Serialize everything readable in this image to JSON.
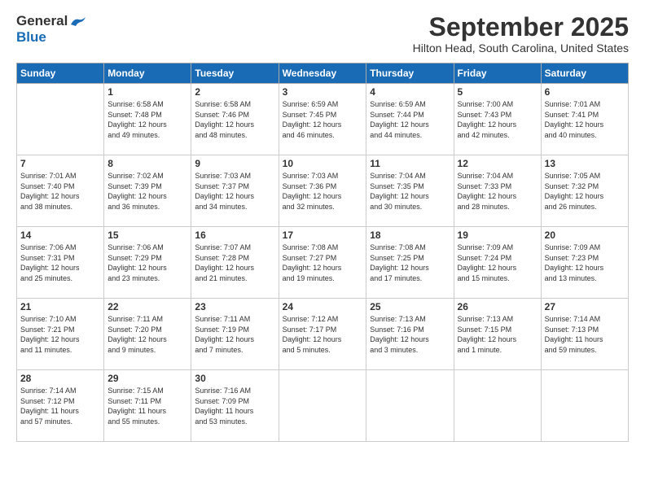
{
  "header": {
    "logo_general": "General",
    "logo_blue": "Blue",
    "month_title": "September 2025",
    "location": "Hilton Head, South Carolina, United States"
  },
  "calendar": {
    "days_of_week": [
      "Sunday",
      "Monday",
      "Tuesday",
      "Wednesday",
      "Thursday",
      "Friday",
      "Saturday"
    ],
    "weeks": [
      [
        {
          "day": "",
          "info": ""
        },
        {
          "day": "1",
          "info": "Sunrise: 6:58 AM\nSunset: 7:48 PM\nDaylight: 12 hours\nand 49 minutes."
        },
        {
          "day": "2",
          "info": "Sunrise: 6:58 AM\nSunset: 7:46 PM\nDaylight: 12 hours\nand 48 minutes."
        },
        {
          "day": "3",
          "info": "Sunrise: 6:59 AM\nSunset: 7:45 PM\nDaylight: 12 hours\nand 46 minutes."
        },
        {
          "day": "4",
          "info": "Sunrise: 6:59 AM\nSunset: 7:44 PM\nDaylight: 12 hours\nand 44 minutes."
        },
        {
          "day": "5",
          "info": "Sunrise: 7:00 AM\nSunset: 7:43 PM\nDaylight: 12 hours\nand 42 minutes."
        },
        {
          "day": "6",
          "info": "Sunrise: 7:01 AM\nSunset: 7:41 PM\nDaylight: 12 hours\nand 40 minutes."
        }
      ],
      [
        {
          "day": "7",
          "info": "Sunrise: 7:01 AM\nSunset: 7:40 PM\nDaylight: 12 hours\nand 38 minutes."
        },
        {
          "day": "8",
          "info": "Sunrise: 7:02 AM\nSunset: 7:39 PM\nDaylight: 12 hours\nand 36 minutes."
        },
        {
          "day": "9",
          "info": "Sunrise: 7:03 AM\nSunset: 7:37 PM\nDaylight: 12 hours\nand 34 minutes."
        },
        {
          "day": "10",
          "info": "Sunrise: 7:03 AM\nSunset: 7:36 PM\nDaylight: 12 hours\nand 32 minutes."
        },
        {
          "day": "11",
          "info": "Sunrise: 7:04 AM\nSunset: 7:35 PM\nDaylight: 12 hours\nand 30 minutes."
        },
        {
          "day": "12",
          "info": "Sunrise: 7:04 AM\nSunset: 7:33 PM\nDaylight: 12 hours\nand 28 minutes."
        },
        {
          "day": "13",
          "info": "Sunrise: 7:05 AM\nSunset: 7:32 PM\nDaylight: 12 hours\nand 26 minutes."
        }
      ],
      [
        {
          "day": "14",
          "info": "Sunrise: 7:06 AM\nSunset: 7:31 PM\nDaylight: 12 hours\nand 25 minutes."
        },
        {
          "day": "15",
          "info": "Sunrise: 7:06 AM\nSunset: 7:29 PM\nDaylight: 12 hours\nand 23 minutes."
        },
        {
          "day": "16",
          "info": "Sunrise: 7:07 AM\nSunset: 7:28 PM\nDaylight: 12 hours\nand 21 minutes."
        },
        {
          "day": "17",
          "info": "Sunrise: 7:08 AM\nSunset: 7:27 PM\nDaylight: 12 hours\nand 19 minutes."
        },
        {
          "day": "18",
          "info": "Sunrise: 7:08 AM\nSunset: 7:25 PM\nDaylight: 12 hours\nand 17 minutes."
        },
        {
          "day": "19",
          "info": "Sunrise: 7:09 AM\nSunset: 7:24 PM\nDaylight: 12 hours\nand 15 minutes."
        },
        {
          "day": "20",
          "info": "Sunrise: 7:09 AM\nSunset: 7:23 PM\nDaylight: 12 hours\nand 13 minutes."
        }
      ],
      [
        {
          "day": "21",
          "info": "Sunrise: 7:10 AM\nSunset: 7:21 PM\nDaylight: 12 hours\nand 11 minutes."
        },
        {
          "day": "22",
          "info": "Sunrise: 7:11 AM\nSunset: 7:20 PM\nDaylight: 12 hours\nand 9 minutes."
        },
        {
          "day": "23",
          "info": "Sunrise: 7:11 AM\nSunset: 7:19 PM\nDaylight: 12 hours\nand 7 minutes."
        },
        {
          "day": "24",
          "info": "Sunrise: 7:12 AM\nSunset: 7:17 PM\nDaylight: 12 hours\nand 5 minutes."
        },
        {
          "day": "25",
          "info": "Sunrise: 7:13 AM\nSunset: 7:16 PM\nDaylight: 12 hours\nand 3 minutes."
        },
        {
          "day": "26",
          "info": "Sunrise: 7:13 AM\nSunset: 7:15 PM\nDaylight: 12 hours\nand 1 minute."
        },
        {
          "day": "27",
          "info": "Sunrise: 7:14 AM\nSunset: 7:13 PM\nDaylight: 11 hours\nand 59 minutes."
        }
      ],
      [
        {
          "day": "28",
          "info": "Sunrise: 7:14 AM\nSunset: 7:12 PM\nDaylight: 11 hours\nand 57 minutes."
        },
        {
          "day": "29",
          "info": "Sunrise: 7:15 AM\nSunset: 7:11 PM\nDaylight: 11 hours\nand 55 minutes."
        },
        {
          "day": "30",
          "info": "Sunrise: 7:16 AM\nSunset: 7:09 PM\nDaylight: 11 hours\nand 53 minutes."
        },
        {
          "day": "",
          "info": ""
        },
        {
          "day": "",
          "info": ""
        },
        {
          "day": "",
          "info": ""
        },
        {
          "day": "",
          "info": ""
        }
      ]
    ]
  }
}
